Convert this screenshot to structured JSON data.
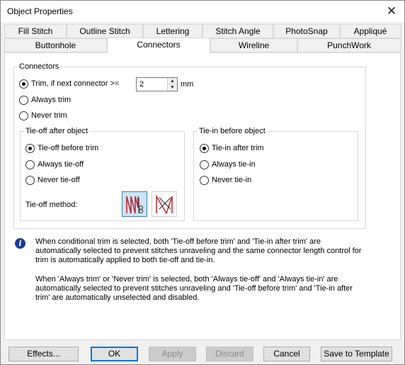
{
  "window": {
    "title": "Object Properties",
    "close_glyph": "✕"
  },
  "tabs_row1": [
    "Fill Stitch",
    "Outline Stitch",
    "Lettering",
    "Stitch Angle",
    "PhotoSnap",
    "Appliqué"
  ],
  "tabs_row2": [
    "Buttonhole",
    "Connectors",
    "Wireline",
    "PunchWork"
  ],
  "active_tab": "Connectors",
  "connectors": {
    "group_label": "Connectors",
    "trim_if_label": "Trim, if next connector >=",
    "trim_value": "2",
    "unit": "mm",
    "always_trim": "Always trim",
    "never_trim": "Never trim",
    "selected": "trim_if"
  },
  "tieoff": {
    "group_label": "Tie-off after object",
    "before_trim": "Tie-off before trim",
    "always": "Always tie-off",
    "never": "Never tie-off",
    "selected": "before_trim",
    "method_label": "Tie-off method:"
  },
  "tiein": {
    "group_label": "Tie-in before object",
    "after_trim": "Tie-in after trim",
    "always": "Always tie-in",
    "never": "Never tie-in",
    "selected": "after_trim"
  },
  "info": {
    "icon": "info-icon",
    "line1": "When conditional trim is selected, both 'Tie-off before trim' and 'Tie-in after trim' are",
    "line2": "automatically selected to prevent stitches unraveling and the same connector length control for",
    "line3": "trim is automatically applied to both tie-off and tie-in.",
    "line4": "When 'Always trim' or 'Never trim' is selected, both 'Always tie-off' and 'Always tie-in' are",
    "line5": "automatically selected to prevent stitches unraveling and 'Tie-off before trim' and 'Tie-in after",
    "line6": "trim' are automatically unselected and disabled."
  },
  "buttons": {
    "effects": "Effects...",
    "ok": "OK",
    "apply": "Apply",
    "discard": "Discard",
    "cancel": "Cancel",
    "save_template": "Save to Template"
  },
  "colors": {
    "accent": "#0078d7",
    "info_blue": "#1b3a9a",
    "stitch_red": "#c0202a"
  }
}
